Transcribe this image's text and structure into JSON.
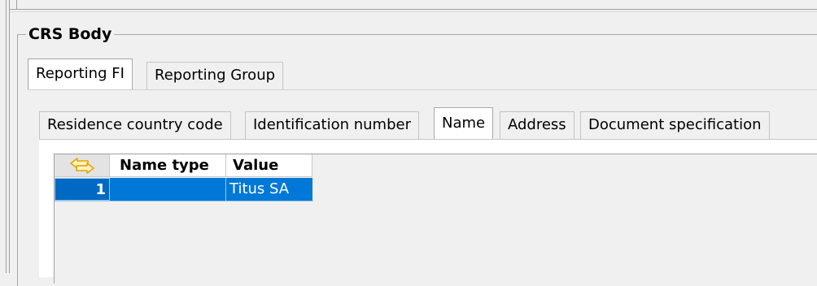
{
  "groupbox": {
    "title": "CRS Body"
  },
  "outer_tabs": [
    {
      "label": "Reporting FI",
      "selected": true
    },
    {
      "label": "Reporting Group",
      "selected": false
    }
  ],
  "inner_tabs": [
    {
      "label": "Residence country code",
      "selected": false
    },
    {
      "label": "Identification number",
      "selected": false
    },
    {
      "label": "Name",
      "selected": true
    },
    {
      "label": "Address",
      "selected": false
    },
    {
      "label": "Document specification",
      "selected": false
    }
  ],
  "grid": {
    "corner_icon": "swap-arrows-icon",
    "columns": [
      "Name type",
      "Value"
    ],
    "rows": [
      {
        "row_number": "1",
        "name_type": "",
        "value": "Titus SA",
        "selected": true
      }
    ]
  },
  "colors": {
    "selection": "#0078d7",
    "icon": "#e6a400"
  }
}
